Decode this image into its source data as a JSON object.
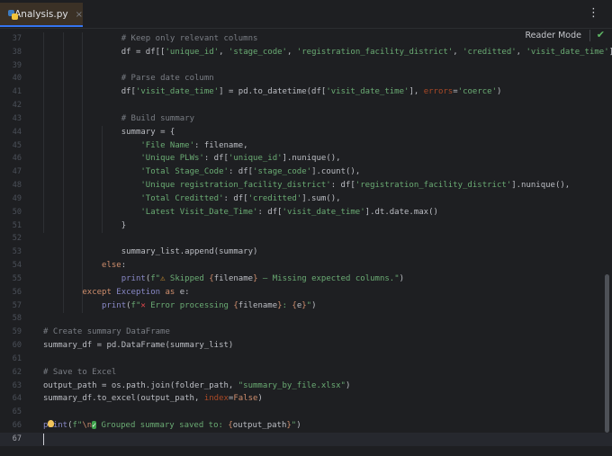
{
  "tab": {
    "title": "Analysis.py",
    "close": "×",
    "icon": "python-file-icon"
  },
  "toolbar": {
    "menu": "⋮",
    "reader_mode": "Reader Mode",
    "check": "✔"
  },
  "colors": {
    "background": "#1e1f22",
    "accent": "#3574f0",
    "string": "#6aab73",
    "keyword": "#cf8e6d",
    "comment": "#7a7e85"
  },
  "editor": {
    "current_line": 67,
    "lines": [
      {
        "n": "37",
        "indent": 16,
        "tokens": [
          [
            "c",
            "# Keep only relevant columns"
          ]
        ]
      },
      {
        "n": "38",
        "indent": 16,
        "tokens": [
          [
            "t",
            "df = df[["
          ],
          [
            "s",
            "'unique_id'"
          ],
          [
            "t",
            ", "
          ],
          [
            "s",
            "'stage_code'"
          ],
          [
            "t",
            ", "
          ],
          [
            "s",
            "'registration_facility_district'"
          ],
          [
            "t",
            ", "
          ],
          [
            "s",
            "'creditted'"
          ],
          [
            "t",
            ", "
          ],
          [
            "s",
            "'visit_date_time'"
          ],
          [
            "t",
            "]]"
          ]
        ]
      },
      {
        "n": "39",
        "indent": 0,
        "tokens": []
      },
      {
        "n": "40",
        "indent": 16,
        "tokens": [
          [
            "c",
            "# Parse date column"
          ]
        ]
      },
      {
        "n": "41",
        "indent": 16,
        "tokens": [
          [
            "t",
            "df["
          ],
          [
            "s",
            "'visit_date_time'"
          ],
          [
            "t",
            "] = pd.to_datetime(df["
          ],
          [
            "s",
            "'visit_date_time'"
          ],
          [
            "t",
            "], "
          ],
          [
            "p",
            "errors"
          ],
          [
            "t",
            "="
          ],
          [
            "s",
            "'coerce'"
          ],
          [
            "t",
            ")"
          ]
        ]
      },
      {
        "n": "42",
        "indent": 0,
        "tokens": []
      },
      {
        "n": "43",
        "indent": 16,
        "tokens": [
          [
            "c",
            "# Build summary"
          ]
        ]
      },
      {
        "n": "44",
        "indent": 16,
        "tokens": [
          [
            "t",
            "summary = {"
          ]
        ]
      },
      {
        "n": "45",
        "indent": 20,
        "tokens": [
          [
            "s",
            "'File Name'"
          ],
          [
            "t",
            ": filename,"
          ]
        ]
      },
      {
        "n": "46",
        "indent": 20,
        "tokens": [
          [
            "s",
            "'Unique PLWs'"
          ],
          [
            "t",
            ": df["
          ],
          [
            "s",
            "'unique_id'"
          ],
          [
            "t",
            "].nunique(),"
          ]
        ]
      },
      {
        "n": "47",
        "indent": 20,
        "tokens": [
          [
            "s",
            "'Total Stage_Code'"
          ],
          [
            "t",
            ": df["
          ],
          [
            "s",
            "'stage_code'"
          ],
          [
            "t",
            "].count(),"
          ]
        ]
      },
      {
        "n": "48",
        "indent": 20,
        "tokens": [
          [
            "s",
            "'Unique registration_facility_district'"
          ],
          [
            "t",
            ": df["
          ],
          [
            "s",
            "'registration_facility_district'"
          ],
          [
            "t",
            "].nunique(),"
          ]
        ]
      },
      {
        "n": "49",
        "indent": 20,
        "tokens": [
          [
            "s",
            "'Total Creditted'"
          ],
          [
            "t",
            ": df["
          ],
          [
            "s",
            "'creditted'"
          ],
          [
            "t",
            "].sum(),"
          ]
        ]
      },
      {
        "n": "50",
        "indent": 20,
        "tokens": [
          [
            "s",
            "'Latest Visit_Date_Time'"
          ],
          [
            "t",
            ": df["
          ],
          [
            "s",
            "'visit_date_time'"
          ],
          [
            "t",
            "].dt.date.max()"
          ]
        ]
      },
      {
        "n": "51",
        "indent": 16,
        "tokens": [
          [
            "t",
            "}"
          ]
        ]
      },
      {
        "n": "52",
        "indent": 0,
        "tokens": []
      },
      {
        "n": "53",
        "indent": 16,
        "tokens": [
          [
            "t",
            "summary_list.append(summary)"
          ]
        ]
      },
      {
        "n": "54",
        "indent": 12,
        "tokens": [
          [
            "k",
            "else"
          ],
          [
            "t",
            ":"
          ]
        ]
      },
      {
        "n": "55",
        "indent": 16,
        "tokens": [
          [
            "b",
            "print"
          ],
          [
            "t",
            "("
          ],
          [
            "s",
            "f\""
          ],
          [
            "warn",
            "⚠"
          ],
          [
            "s",
            " Skipped "
          ],
          [
            "e",
            "{"
          ],
          [
            "t",
            "filename"
          ],
          [
            "e",
            "}"
          ],
          [
            "s",
            " — Missing expected columns.\""
          ],
          [
            "t",
            ")"
          ]
        ]
      },
      {
        "n": "56",
        "indent": 8,
        "tokens": [
          [
            "k",
            "except "
          ],
          [
            "n",
            "Exception"
          ],
          [
            "k",
            " as "
          ],
          [
            "t",
            "e:"
          ]
        ]
      },
      {
        "n": "57",
        "indent": 12,
        "tokens": [
          [
            "b",
            "print"
          ],
          [
            "t",
            "("
          ],
          [
            "s",
            "f\""
          ],
          [
            "x",
            "✕"
          ],
          [
            "s",
            " Error processing "
          ],
          [
            "e",
            "{"
          ],
          [
            "t",
            "filename"
          ],
          [
            "e",
            "}"
          ],
          [
            "s",
            ": "
          ],
          [
            "e",
            "{"
          ],
          [
            "t",
            "e"
          ],
          [
            "e",
            "}"
          ],
          [
            "s",
            "\""
          ],
          [
            "t",
            ")"
          ]
        ]
      },
      {
        "n": "58",
        "indent": 0,
        "tokens": []
      },
      {
        "n": "59",
        "indent": 0,
        "tokens": [
          [
            "c",
            "# Create summary DataFrame"
          ]
        ]
      },
      {
        "n": "60",
        "indent": 0,
        "tokens": [
          [
            "t",
            "summary_df = pd.DataFrame(summary_list)"
          ]
        ]
      },
      {
        "n": "61",
        "indent": 0,
        "tokens": []
      },
      {
        "n": "62",
        "indent": 0,
        "tokens": [
          [
            "c",
            "# Save to Excel"
          ]
        ]
      },
      {
        "n": "63",
        "indent": 0,
        "tokens": [
          [
            "t",
            "output_path = os.path.join(folder_path, "
          ],
          [
            "s",
            "\"summary_by_file.xlsx\""
          ],
          [
            "t",
            ")"
          ]
        ]
      },
      {
        "n": "64",
        "indent": 0,
        "tokens": [
          [
            "t",
            "summary_df.to_excel(output_path, "
          ],
          [
            "p",
            "index"
          ],
          [
            "t",
            "="
          ],
          [
            "k",
            "False"
          ],
          [
            "t",
            ")"
          ]
        ]
      },
      {
        "n": "65",
        "indent": 0,
        "tokens": []
      },
      {
        "n": "66",
        "indent": 0,
        "tokens": [
          [
            "b",
            "print"
          ],
          [
            "t",
            "("
          ],
          [
            "s",
            "f\""
          ],
          [
            "e",
            "\\n"
          ],
          [
            "ok",
            "✓"
          ],
          [
            "s",
            " Grouped summary saved to: "
          ],
          [
            "e",
            "{"
          ],
          [
            "t",
            "output_path"
          ],
          [
            "e",
            "}"
          ],
          [
            "s",
            "\""
          ],
          [
            "t",
            ")"
          ]
        ]
      },
      {
        "n": "67",
        "indent": 0,
        "tokens": []
      }
    ]
  }
}
